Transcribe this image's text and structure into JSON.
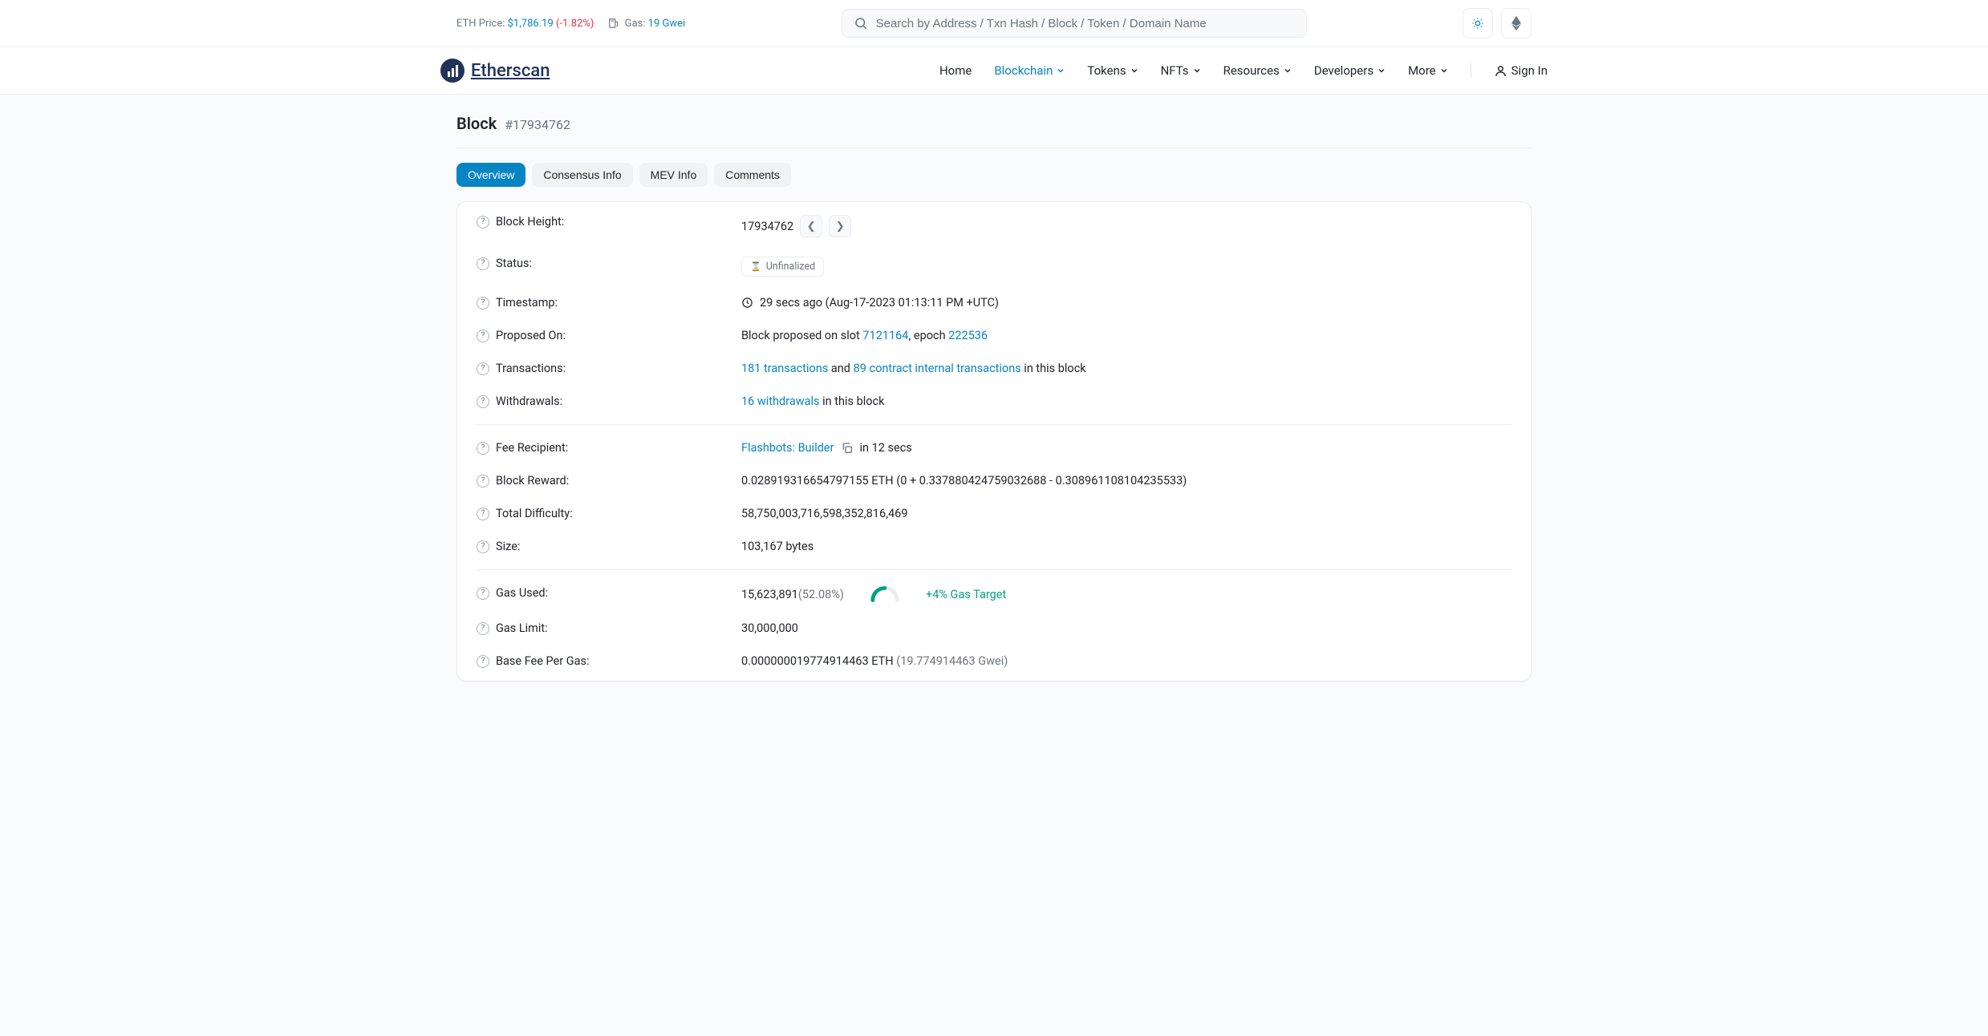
{
  "topbar": {
    "eth_price_label": "ETH Price: ",
    "eth_price": "$1,786.19",
    "eth_change": " (-1.82%)",
    "gas_label": " Gas: ",
    "gas_value": "19 Gwei"
  },
  "search": {
    "placeholder": "Search by Address / Txn Hash / Block / Token / Domain Name"
  },
  "logo": "Etherscan",
  "nav": {
    "home": "Home",
    "blockchain": "Blockchain",
    "tokens": "Tokens",
    "nfts": "NFTs",
    "resources": "Resources",
    "developers": "Developers",
    "more": "More",
    "signin": "Sign In"
  },
  "page": {
    "title": "Block",
    "number": "#17934762"
  },
  "tabs": {
    "overview": "Overview",
    "consensus": "Consensus Info",
    "mev": "MEV Info",
    "comments": "Comments"
  },
  "labels": {
    "height": "Block Height:",
    "status": "Status:",
    "timestamp": "Timestamp:",
    "proposed": "Proposed On:",
    "transactions": "Transactions:",
    "withdrawals": "Withdrawals:",
    "fee_recipient": "Fee Recipient:",
    "block_reward": "Block Reward:",
    "total_difficulty": "Total Difficulty:",
    "size": "Size:",
    "gas_used": "Gas Used:",
    "gas_limit": "Gas Limit:",
    "base_fee": "Base Fee Per Gas:"
  },
  "values": {
    "height": "17934762",
    "status_badge": "Unfinalized",
    "timestamp_ago": "29 secs ago ",
    "timestamp_full": "(Aug-17-2023 01:13:11 PM +UTC)",
    "proposed_pre": "Block proposed on slot ",
    "proposed_slot": "7121164",
    "proposed_mid": ", epoch ",
    "proposed_epoch": "222536",
    "tx_link": "181 transactions",
    "tx_and": " and ",
    "tx_internal": "89 contract internal transactions",
    "tx_suffix": " in this block",
    "withdrawals_link": "16 withdrawals",
    "withdrawals_suffix": " in this block",
    "fee_recipient_name": "Flashbots: Builder",
    "fee_recipient_time": " in 12 secs",
    "block_reward": "0.028919316654797155 ETH (0 + 0.337880424759032688 - 0.308961108104235533)",
    "total_difficulty": "58,750,003,716,598,352,816,469",
    "size": "103,167 bytes",
    "gas_used": "15,623,891",
    "gas_used_pct": "(52.08%)",
    "gas_target": "+4% Gas Target",
    "gas_limit": "30,000,000",
    "base_fee_eth": "0.000000019774914463 ETH ",
    "base_fee_gwei": "(19.774914463 Gwei)"
  }
}
